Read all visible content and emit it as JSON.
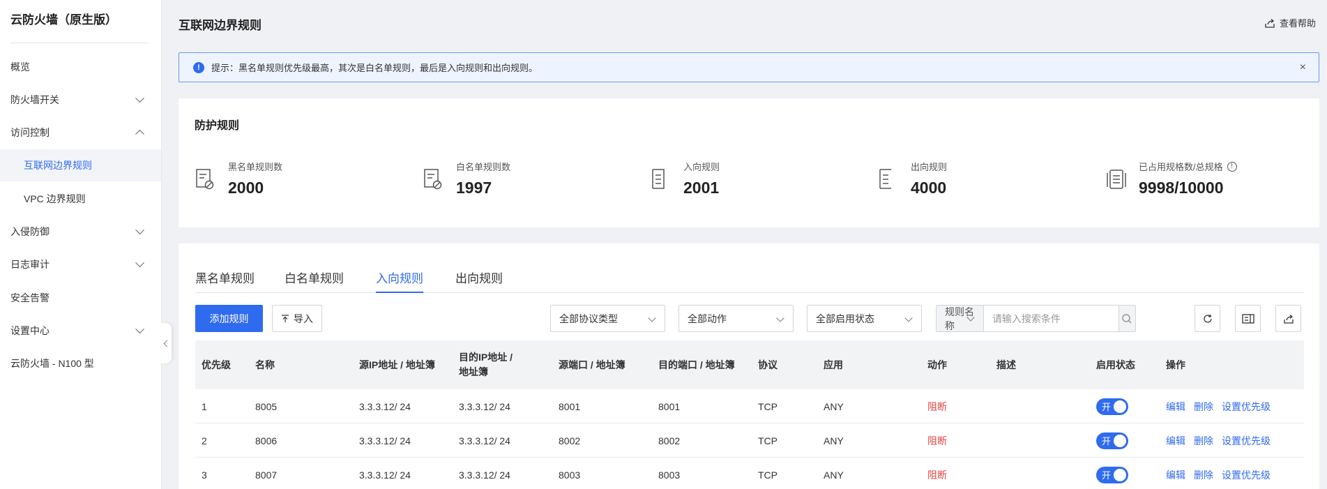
{
  "sidebar": {
    "brand": "云防火墙（原生版）",
    "items": [
      {
        "label": "概览"
      },
      {
        "label": "防火墙开关"
      },
      {
        "label": "访问控制"
      },
      {
        "label": "互联网边界规则"
      },
      {
        "label": "VPC 边界规则"
      },
      {
        "label": "入侵防御"
      },
      {
        "label": "日志审计"
      },
      {
        "label": "安全告警"
      },
      {
        "label": "设置中心"
      },
      {
        "label": "云防火墙 - N100 型"
      }
    ]
  },
  "header": {
    "title": "互联网边界规则",
    "help": "查看帮助"
  },
  "alert": {
    "icon": "!",
    "text": "提示：黑名单规则优先级最高，其次是白名单规则，最后是入向规则和出向规则。",
    "close": "×"
  },
  "stats": {
    "title": "防护规则",
    "items": [
      {
        "label": "黑名单规则数",
        "value": "2000"
      },
      {
        "label": "白名单规则数",
        "value": "1997"
      },
      {
        "label": "入向规则",
        "value": "2001"
      },
      {
        "label": "出向规则",
        "value": "4000"
      },
      {
        "label": "已占用规格数/总规格",
        "value": "9998/10000"
      }
    ]
  },
  "rules": {
    "tabs": [
      "黑名单规则",
      "白名单规则",
      "入向规则",
      "出向规则"
    ],
    "active_tab": "入向规则",
    "add_button": "添加规则",
    "import_button": "导入",
    "filters": {
      "protocol": "全部协议类型",
      "action": "全部动作",
      "status": "全部启用状态"
    },
    "search": {
      "field": "规则名称",
      "placeholder": "请输入搜索条件"
    },
    "columns": {
      "priority": "优先级",
      "name": "名称",
      "src_ip_1": "源IP地址 / 地址簿",
      "dst_ip_1": "目的IP地址 /",
      "dst_ip_2": "地址簿",
      "src_port": "源端口 / 地址簿",
      "dst_port": "目的端口 / 地址簿",
      "protocol": "协议",
      "app": "应用",
      "action": "动作",
      "desc": "描述",
      "status": "启用状态",
      "ops": "操作"
    },
    "rows": [
      {
        "priority": "1",
        "name": "8005",
        "src_ip": "3.3.3.12/ 24",
        "dst_ip": "3.3.3.12/ 24",
        "src_port": "8001",
        "dst_port": "8001",
        "protocol": "TCP",
        "app": "ANY",
        "action": "阻断",
        "desc": "",
        "toggle": "开"
      },
      {
        "priority": "2",
        "name": "8006",
        "src_ip": "3.3.3.12/ 24",
        "dst_ip": "3.3.3.12/ 24",
        "src_port": "8002",
        "dst_port": "8002",
        "protocol": "TCP",
        "app": "ANY",
        "action": "阻断",
        "desc": "",
        "toggle": "开"
      },
      {
        "priority": "3",
        "name": "8007",
        "src_ip": "3.3.3.12/ 24",
        "dst_ip": "3.3.3.12/ 24",
        "src_port": "8003",
        "dst_port": "8003",
        "protocol": "TCP",
        "app": "ANY",
        "action": "阻断",
        "desc": "",
        "toggle": "开"
      }
    ],
    "ops": {
      "edit": "编辑",
      "delete": "删除",
      "priority": "设置优先级"
    }
  },
  "colors": {
    "accent": "#2f6bef",
    "danger": "#e04545",
    "page_bg": "#eff1f5"
  }
}
